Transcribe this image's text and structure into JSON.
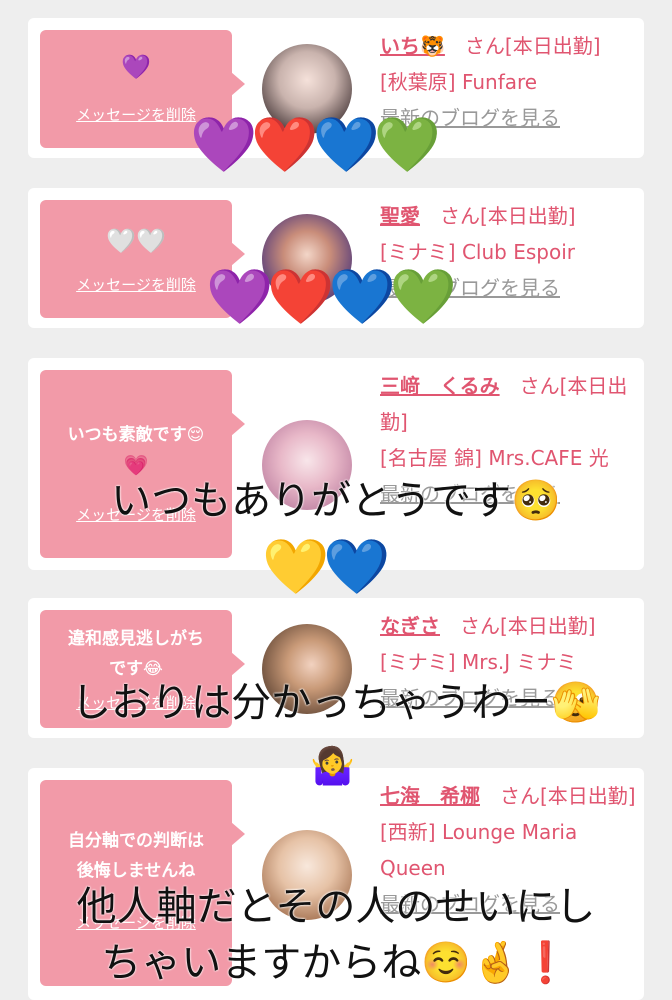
{
  "items": [
    {
      "bubble_emoji": "💜",
      "bubble_text": "",
      "delete_label": "メッセージを削除",
      "name": "いち🐯",
      "suffix": "さん[本日出勤]",
      "shop": "[秋葉原] Funfare",
      "blog": "最新のブログを見る"
    },
    {
      "bubble_emoji": "🤍🤍",
      "bubble_text": "",
      "delete_label": "メッセージを削除",
      "name": "聖愛",
      "suffix": "さん[本日出勤]",
      "shop": "[ミナミ] Club Espoir",
      "blog": "最新のブログを見る"
    },
    {
      "bubble_emoji": "💗",
      "bubble_text": "いつも素敵です😌",
      "delete_label": "メッセージを削除",
      "name": "三﨑　くるみ",
      "suffix": "さん[本日出勤]",
      "shop": "[名古屋 錦] Mrs.CAFE 光",
      "blog": "最新のブログを見る"
    },
    {
      "bubble_emoji": "",
      "bubble_text": "違和感見逃しがちです😂",
      "delete_label": "メッセージを削除",
      "name": "なぎさ",
      "suffix": "さん[本日出勤]",
      "shop": "[ミナミ] Mrs.J ミナミ",
      "blog": "最新のブログを見る"
    },
    {
      "bubble_emoji": "",
      "bubble_text": "自分軸での判断は後悔しませんね",
      "delete_label": "メッセージを削除",
      "name": "七海　希梛",
      "suffix": "さん[本日出勤]",
      "shop": "[西新] Lounge Maria Queen",
      "blog": "最新のブログを見る"
    }
  ],
  "overlay": {
    "hearts1": "💜❤️💙💚",
    "hearts2": "💜❤️💙💚",
    "text1": "いつもありがとうです🥺",
    "hearts3": "💛💙",
    "text2": "しおりは分かっちゃうわー🫣",
    "emoji_shrug": "🤷‍♀️",
    "text3": "他人軸だとその人のせいにし",
    "text4": "ちゃいますからね☺️🤞❗️"
  },
  "colors": {
    "bubble": "#f29aa8",
    "name": "#e05570",
    "background": "#eeeeee"
  }
}
